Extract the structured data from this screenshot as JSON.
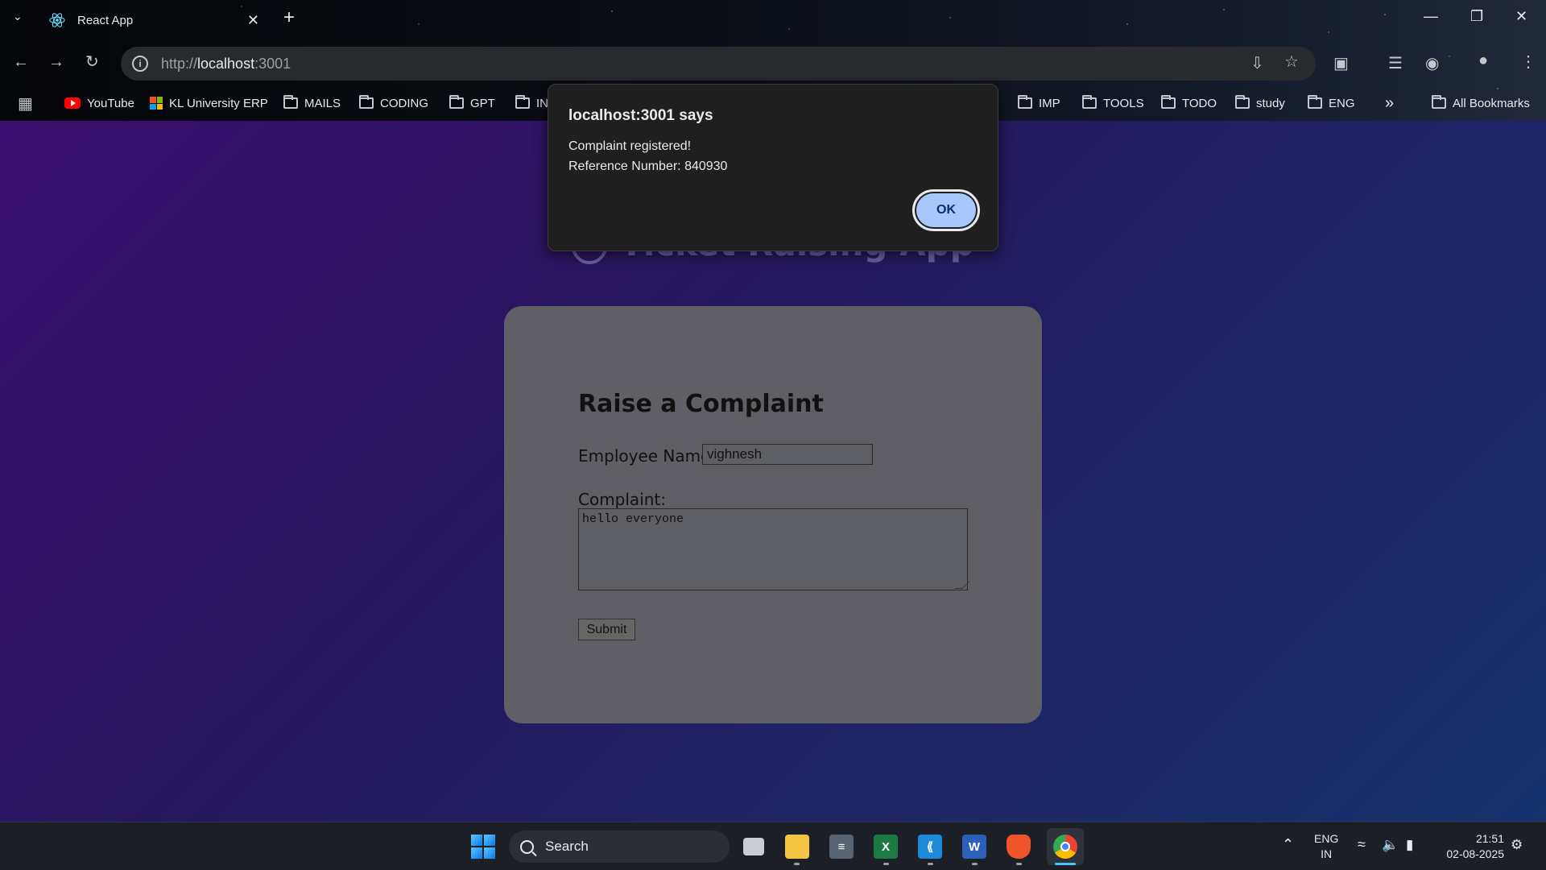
{
  "browser": {
    "tab": {
      "title": "React App"
    },
    "url": {
      "scheme": "http://",
      "host": "localhost",
      "port": ":3001"
    },
    "bookmarks": [
      {
        "label": "YouTube",
        "icon": "youtube-icon"
      },
      {
        "label": "KL University ERP",
        "icon": "microsoft-icon"
      },
      {
        "label": "MAILS",
        "icon": "folder-icon"
      },
      {
        "label": "CODING",
        "icon": "folder-icon"
      },
      {
        "label": "GPT",
        "icon": "folder-icon"
      },
      {
        "label": "IN",
        "icon": "folder-icon"
      },
      {
        "label": "IMP",
        "icon": "folder-icon"
      },
      {
        "label": "TOOLS",
        "icon": "folder-icon"
      },
      {
        "label": "TODO",
        "icon": "folder-icon"
      },
      {
        "label": "study",
        "icon": "folder-icon"
      },
      {
        "label": "ENG",
        "icon": "folder-icon"
      }
    ],
    "overflow_label": "»",
    "all_bookmarks": "All Bookmarks"
  },
  "page": {
    "title": "Ticket Raising App",
    "card": {
      "heading": "Raise a Complaint",
      "name_label": "Employee Name:",
      "name_value": "vighnesh",
      "complaint_label": "Complaint:",
      "complaint_value": "hello everyone",
      "submit_label": "Submit"
    }
  },
  "dialog": {
    "title": "localhost:3001 says",
    "line1": "Complaint registered!",
    "line2": "Reference Number: 840930",
    "ok_label": "OK"
  },
  "taskbar": {
    "search_label": "Search",
    "language": "ENG",
    "region": "IN",
    "time": "21:51",
    "date": "02-08-2025"
  },
  "colors": {
    "accent": "#a8c7fa",
    "page_gradient_start": "#3a0e6e",
    "page_gradient_end": "#16336e",
    "card_bg": "#605f66"
  }
}
